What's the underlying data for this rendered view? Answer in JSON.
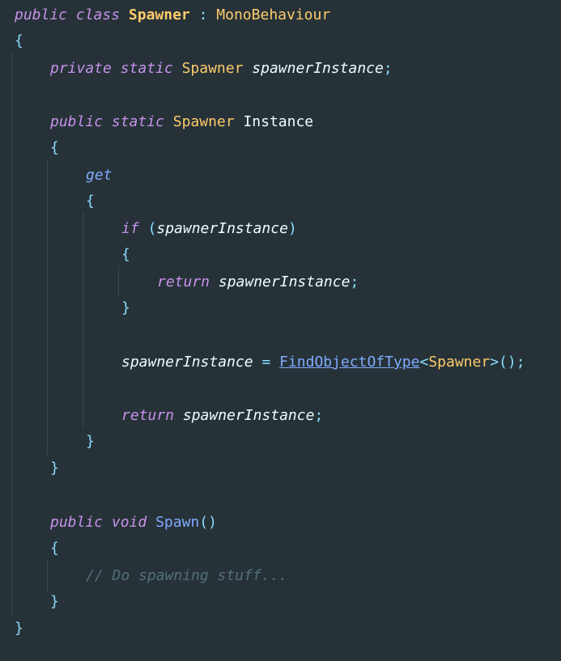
{
  "code": {
    "class_decl": {
      "kw_public": "public",
      "kw_class": "class",
      "name": "Spawner",
      "colon": ":",
      "base": "MonoBehaviour"
    },
    "brace_open": "{",
    "brace_close": "}",
    "field_decl": {
      "kw_private": "private",
      "kw_static": "static",
      "type": "Spawner",
      "name": "spawnerInstance",
      "semicolon": ";"
    },
    "prop_decl": {
      "kw_public": "public",
      "kw_static": "static",
      "type": "Spawner",
      "name": "Instance"
    },
    "getter": {
      "kw_get": "get",
      "if_line": {
        "kw_if": "if",
        "paren_open": "(",
        "var": "spawnerInstance",
        "paren_close": ")"
      },
      "return_line_1": {
        "kw_return": "return",
        "var": "spawnerInstance",
        "semicolon": ";"
      },
      "assign_line": {
        "var": "spawnerInstance",
        "op": "=",
        "call": "FindObjectOfType",
        "generic_open": "<",
        "generic_type": "Spawner",
        "generic_close_call": ">();"
      },
      "return_line_2": {
        "kw_return": "return",
        "var": "spawnerInstance",
        "semicolon": ";"
      }
    },
    "method_decl": {
      "kw_public": "public",
      "kw_void": "void",
      "name": "Spawn",
      "parens": "()"
    },
    "comment": "// Do spawning stuff..."
  },
  "colors": {
    "background": "#263238",
    "keyword": "#C792EA",
    "type": "#FFCB6B",
    "punctuation": "#89DDFF",
    "function": "#82AAFF",
    "variable": "#EEFFFF",
    "comment": "#546E7A",
    "indent_guide": "#37474F"
  }
}
